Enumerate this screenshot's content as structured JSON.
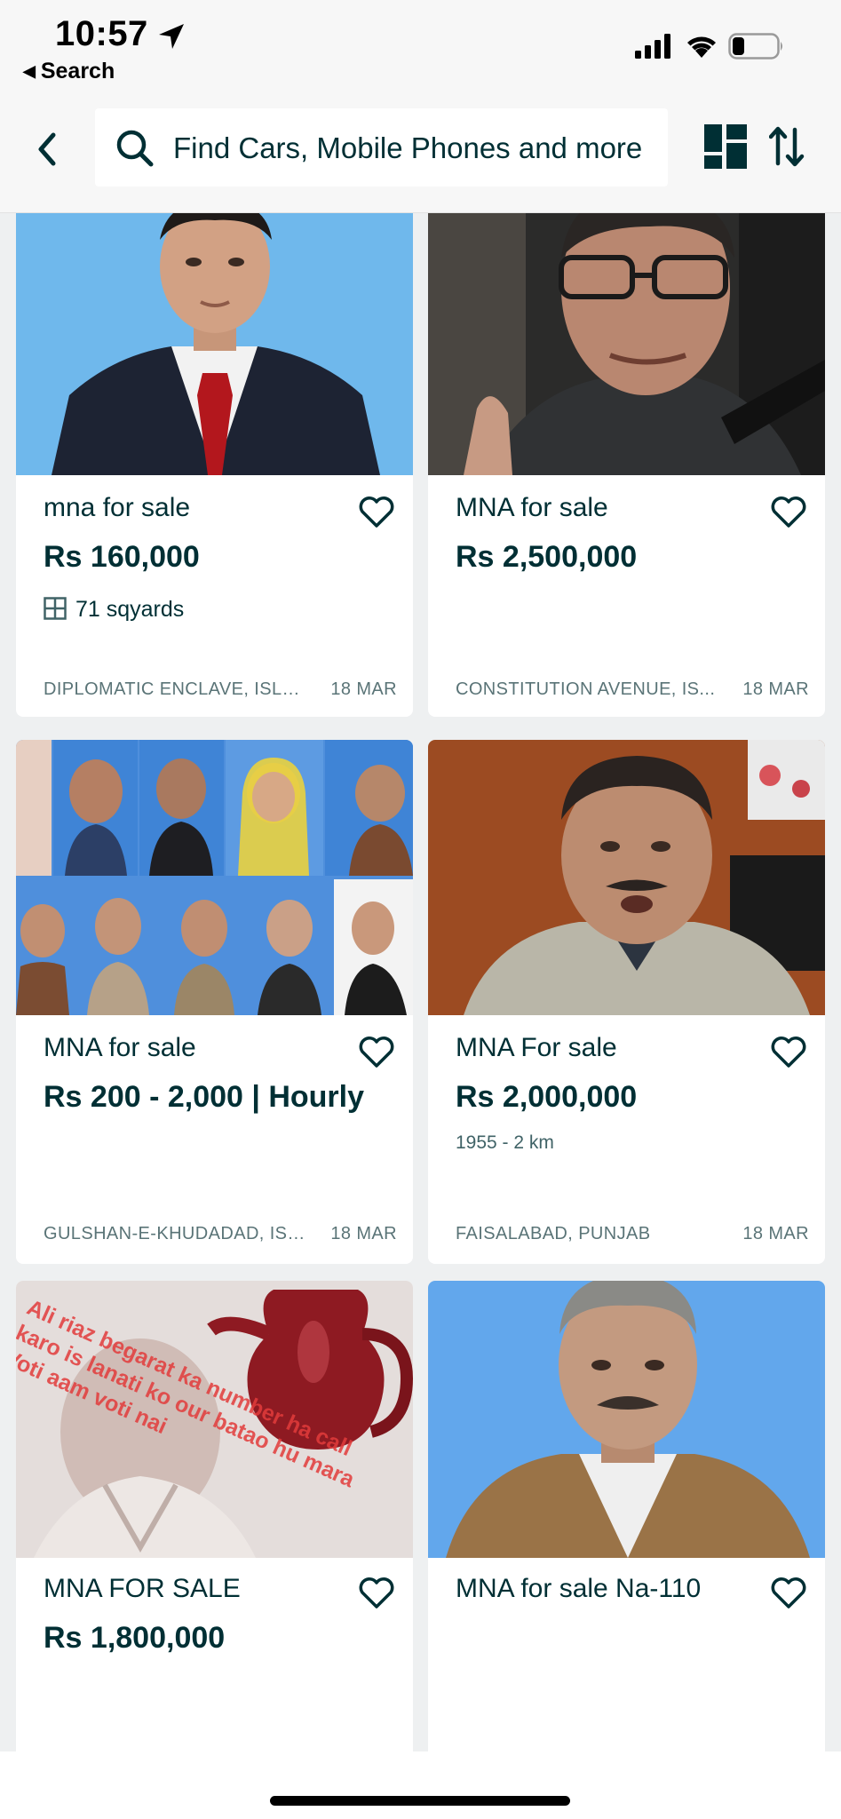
{
  "status_bar": {
    "time": "10:57",
    "back_app_label": "Search"
  },
  "search": {
    "placeholder": "Find Cars, Mobile Phones and more"
  },
  "listings": [
    {
      "title": "mna for sale",
      "price": "Rs 160,000",
      "area": "71 sqyards",
      "location": "DIPLOMATIC ENCLAVE, ISLA...",
      "date": "18 MAR"
    },
    {
      "title": "MNA for sale",
      "price": "Rs 2,500,000",
      "location": "CONSTITUTION AVENUE, IS...",
      "date": "18 MAR"
    },
    {
      "title": "MNA for sale",
      "price": "Rs 200 - 2,000 | Hourly",
      "location": "GULSHAN-E-KHUDADAD, ISL...",
      "date": "18 MAR"
    },
    {
      "title": "MNA For sale",
      "price": "Rs 2,000,000",
      "detail": "1955 - 2 km",
      "location": "FAISALABAD, PUNJAB",
      "date": "18 MAR"
    },
    {
      "title": "MNA FOR SALE",
      "price": "Rs 1,800,000",
      "overlay_text": "Ali riaz begarat ka number ha call karo is lanati ko our batao hu mara Voti aam voti nai"
    },
    {
      "title": "MNA for sale Na-110"
    }
  ],
  "colors": {
    "text_primary": "#002f34",
    "background": "#eef0f1",
    "card": "#ffffff"
  }
}
